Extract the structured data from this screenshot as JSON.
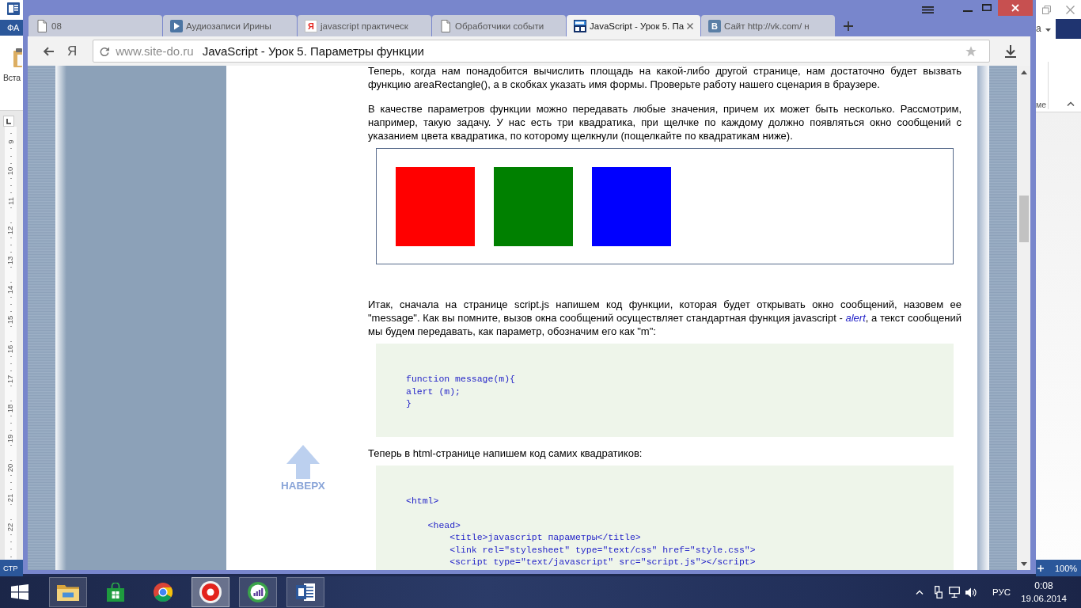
{
  "word_window": {
    "file_tab": "ФА",
    "paste_label": "Вста",
    "ruler_numbers": [
      "9",
      "10",
      "11",
      "12",
      "13",
      "14",
      "15",
      "16",
      "17",
      "18",
      "19",
      "20",
      "21",
      "22"
    ],
    "status_text": "СТР",
    "account_name": "а",
    "ribbon_label": "ме",
    "zoom_level": "100%"
  },
  "browser": {
    "tabs": [
      {
        "kind": "page",
        "label": "08",
        "selected": false
      },
      {
        "kind": "play",
        "label": "Аудиозаписи Ирины",
        "selected": false
      },
      {
        "kind": "letter",
        "favicon_text": "Я",
        "label": "javascript практическ",
        "selected": false
      },
      {
        "kind": "page",
        "label": "Обработчики событи",
        "selected": false
      },
      {
        "kind": "logo",
        "label": "JavaScript - Урок 5. Па",
        "selected": true
      },
      {
        "kind": "badge",
        "favicon_text": "В",
        "label": "Сайт http://vk.com/ н",
        "selected": false
      }
    ],
    "logo_button": "Я",
    "address": {
      "domain": "www.site-do.ru",
      "title": "JavaScript - Урок 5. Параметры функции"
    },
    "page": {
      "blocks": [
        {
          "kind": "paragraph",
          "text": "Теперь, когда нам понадобится вычислить площадь на какой-либо другой странице, нам достаточно будет вызвать функцию areaRectangle(), а в скобках указать имя формы. Проверьте работу нашего сценария в браузере."
        },
        {
          "kind": "paragraph",
          "text": "В качестве параметров функции можно передавать любые значения, причем их может быть несколько. Рассмотрим, например, такую задачу. У нас есть три квадратика, при щелчке по каждому должно появляться окно сообщений с указанием цвета квадратика, по которому щелкнули (пощелкайте по квадратикам ниже)."
        },
        {
          "kind": "demo",
          "squares": [
            {
              "color": "#ff0000"
            },
            {
              "color": "#008000"
            },
            {
              "color": "#0000ff"
            }
          ]
        },
        {
          "kind": "paragraph",
          "text": "Итак, сначала на странице script.js напишем код функции, которая будет открывать окно сообщений, назовем ее \"message\". Как вы помните, вызов окна сообщений осуществляет стандартная функция javascript - *alert*, а текст сообщений мы будем передавать, как параметр, обозначим его как \"m\":"
        },
        {
          "kind": "code",
          "text": "function message(m){\nalert (m);\n}"
        },
        {
          "kind": "paragraph",
          "text": "Теперь в html-странице напишем код самих квадратиков:"
        },
        {
          "kind": "code",
          "text": "<html>\n\n    <head>\n        <title>javascript параметры</title>\n        <link rel=\"stylesheet\" type=\"text/css\" href=\"style.css\">\n        <script type=\"text/javascript\" src=\"script.js\"></script>"
        }
      ],
      "scroll_top_label": "НАВЕРХ"
    }
  },
  "taskbar": {
    "apps": [
      {
        "kind": "folder",
        "open": true,
        "selected": false
      },
      {
        "kind": "bag",
        "open": false,
        "selected": false
      },
      {
        "kind": "ball",
        "open": false,
        "selected": false
      },
      {
        "kind": "ring",
        "open": true,
        "selected": true
      },
      {
        "kind": "chart",
        "open": true,
        "selected": false
      },
      {
        "kind": "document",
        "open": true,
        "selected": false
      }
    ],
    "language": "РУС",
    "time": "0:08",
    "date": "19.06.2014"
  }
}
